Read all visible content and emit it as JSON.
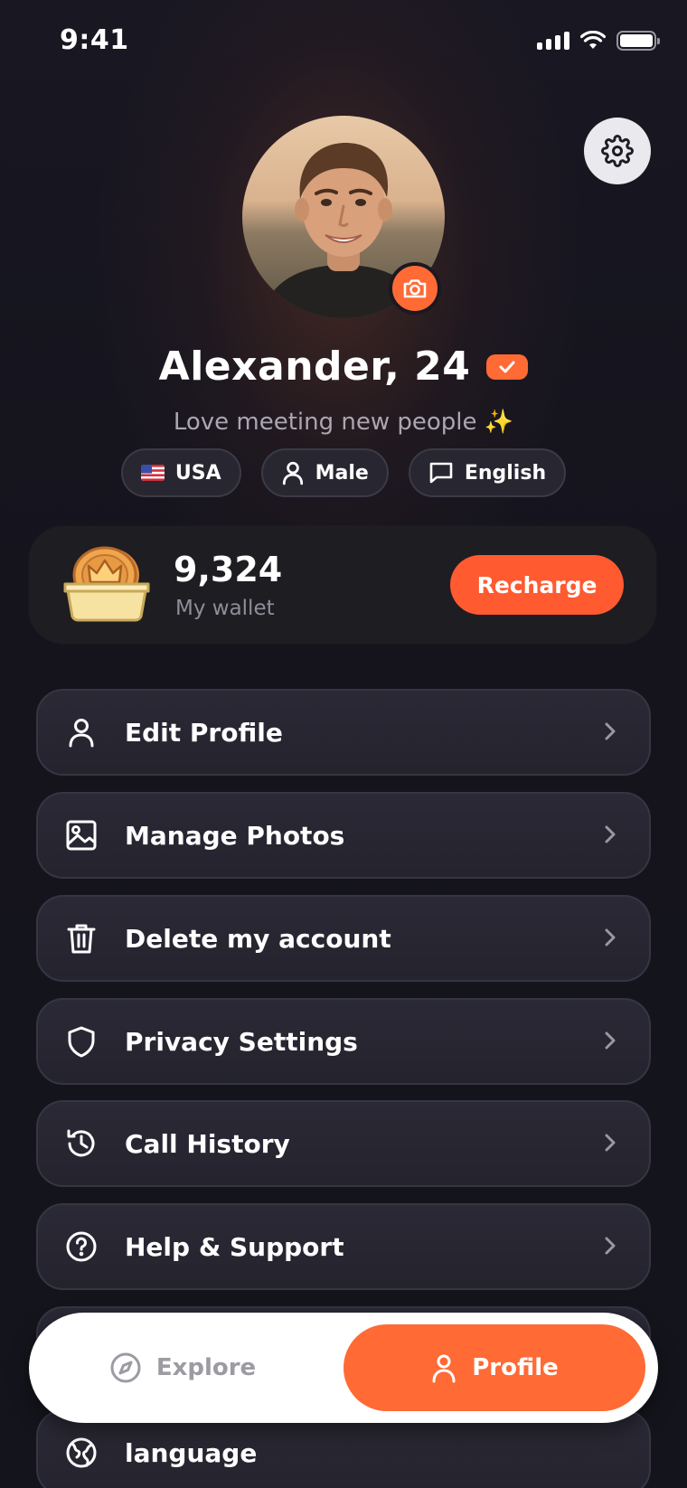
{
  "status_bar": {
    "time": "9:41"
  },
  "profile": {
    "name": "Alexander, 24",
    "bio": "Love meeting new people ✨",
    "chips": [
      {
        "label": "USA",
        "icon": "us-flag-icon"
      },
      {
        "label": "Male",
        "icon": "person-icon"
      },
      {
        "label": "English",
        "icon": "chat-bubble-icon"
      }
    ]
  },
  "wallet": {
    "balance": "9,324",
    "label": "My wallet",
    "recharge_label": "Recharge"
  },
  "menu": {
    "items": [
      {
        "label": "Edit Profile",
        "icon": "person-icon"
      },
      {
        "label": "Manage Photos",
        "icon": "image-icon"
      },
      {
        "label": "Delete my account",
        "icon": "trash-icon"
      },
      {
        "label": "Privacy Settings",
        "icon": "shield-icon"
      },
      {
        "label": "Call History",
        "icon": "history-icon"
      },
      {
        "label": "Help & Support",
        "icon": "help-circle-icon"
      },
      {
        "label": "language",
        "icon": "globe-icon"
      }
    ]
  },
  "bottom_nav": {
    "explore_label": "Explore",
    "profile_label": "Profile",
    "active": "Profile"
  },
  "colors": {
    "accent": "#ff6a35",
    "background": "#14141c",
    "card": "#272631"
  }
}
